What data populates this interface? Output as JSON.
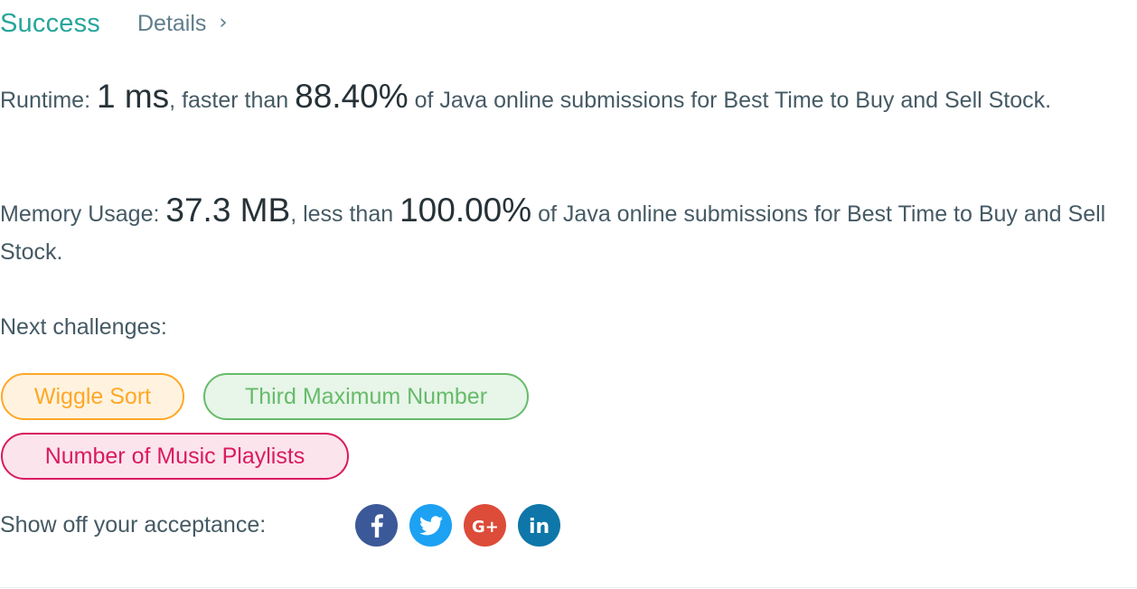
{
  "header": {
    "status": "Success",
    "details_label": "Details",
    "details_chevron": "›"
  },
  "runtime": {
    "label": "Runtime: ",
    "value": "1 ms",
    "mid_text": ", faster than ",
    "percent": "88.40%",
    "suffix": " of Java online submissions for Best Time to Buy and Sell Stock."
  },
  "memory": {
    "label": "Memory Usage: ",
    "value": "37.3 MB",
    "mid_text": ", less than ",
    "percent": "100.00%",
    "suffix": " of Java online submissions for Best Time to Buy and Sell Stock."
  },
  "next": {
    "label": "Next challenges:",
    "challenges": [
      {
        "title": "Wiggle Sort",
        "color": "#ffa726"
      },
      {
        "title": "Third Maximum Number",
        "color": "#66bb6a"
      },
      {
        "title": "Number of Music Playlists",
        "color": "#d81b60"
      }
    ]
  },
  "share": {
    "label": "Show off your acceptance:",
    "icons": [
      {
        "name": "facebook-icon",
        "color": "#3b5998"
      },
      {
        "name": "twitter-icon",
        "color": "#1da1f2"
      },
      {
        "name": "google-plus-icon",
        "color": "#dd4b39"
      },
      {
        "name": "linkedin-icon",
        "color": "#0e76a8"
      }
    ]
  },
  "colors": {
    "success": "#26a69a",
    "text": "#455a64",
    "emphasis": "#263238"
  }
}
